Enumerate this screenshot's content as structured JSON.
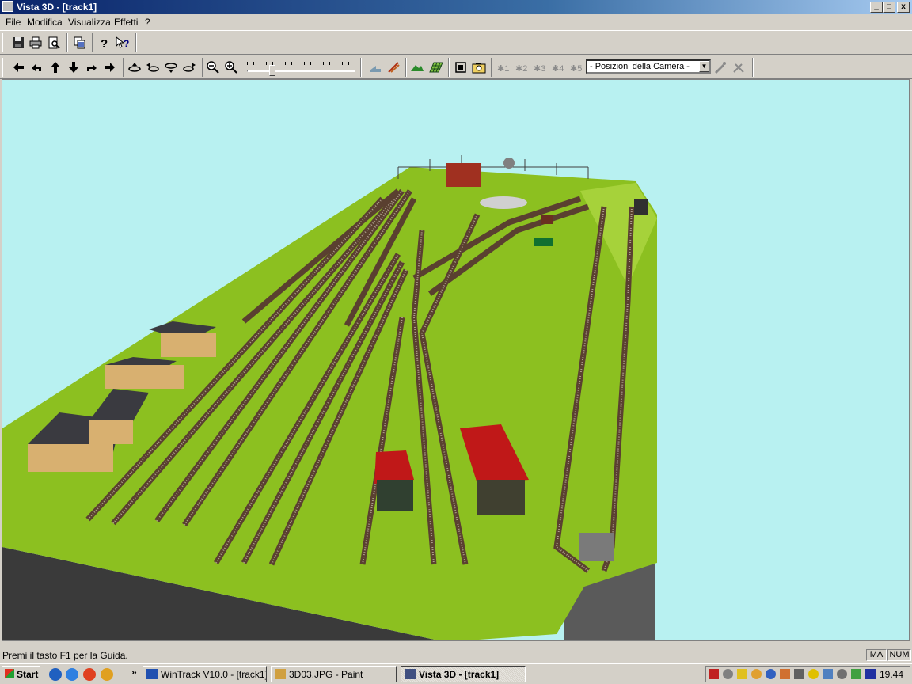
{
  "window": {
    "title": "Vista 3D - [track1]",
    "controls": {
      "minimize": "_",
      "maximize": "□",
      "close": "x"
    }
  },
  "menu": [
    {
      "label": "File"
    },
    {
      "label": "Modifica"
    },
    {
      "label": "Visualizza"
    },
    {
      "label": "Effetti"
    },
    {
      "label": "?"
    }
  ],
  "toolbar1": {
    "icons": [
      "save-icon",
      "print-icon",
      "print-preview-icon",
      "copy-icon",
      "help-icon",
      "context-help-icon"
    ]
  },
  "toolbar2": {
    "navigation_icons": [
      "arrow-left-icon",
      "turn-left-icon",
      "arrow-up-icon",
      "arrow-down-icon",
      "turn-right-icon",
      "arrow-right-icon"
    ],
    "camera_icons": [
      "camera-up-icon",
      "camera-left-icon",
      "camera-down-icon",
      "camera-right-icon"
    ],
    "zoom_icons": [
      "zoom-out-icon",
      "zoom-in-icon"
    ],
    "zoom_slider_fraction": 0.22,
    "view_icons": [
      "ground-icon",
      "rail-icon",
      "landscape-icon",
      "grid-icon",
      "fullscreen-icon",
      "snapshot-icon"
    ],
    "camera_position_icons": [
      "camera-position-1-icon",
      "camera-position-2-icon",
      "camera-position-3-icon",
      "camera-position-4-icon",
      "camera-position-5-icon"
    ],
    "camera_dropdown_value": "- Posizioni della Camera -",
    "edit_icons": [
      "camera-edit-icon",
      "camera-delete-icon"
    ]
  },
  "status": {
    "text": "Premi il tasto F1 per la Guida.",
    "indicators": [
      "MA",
      "NUM"
    ]
  },
  "taskbar": {
    "start_label": "Start",
    "quick_launch": [
      "ie-icon",
      "outlook-icon",
      "media-icon",
      "player-icon"
    ],
    "overflow": "»",
    "tasks": [
      {
        "label": "WinTrack  V10.0 - [track1]",
        "active": false
      },
      {
        "label": "3D03.JPG - Paint",
        "active": false
      },
      {
        "label": "Vista 3D - [track1]",
        "active": true
      }
    ],
    "clock": "19.44"
  },
  "colors": {
    "title_gradient_start": "#0a246a",
    "sky": "#b8f1f1",
    "terrain": "#8cc020",
    "face": "#d4d0c8"
  }
}
